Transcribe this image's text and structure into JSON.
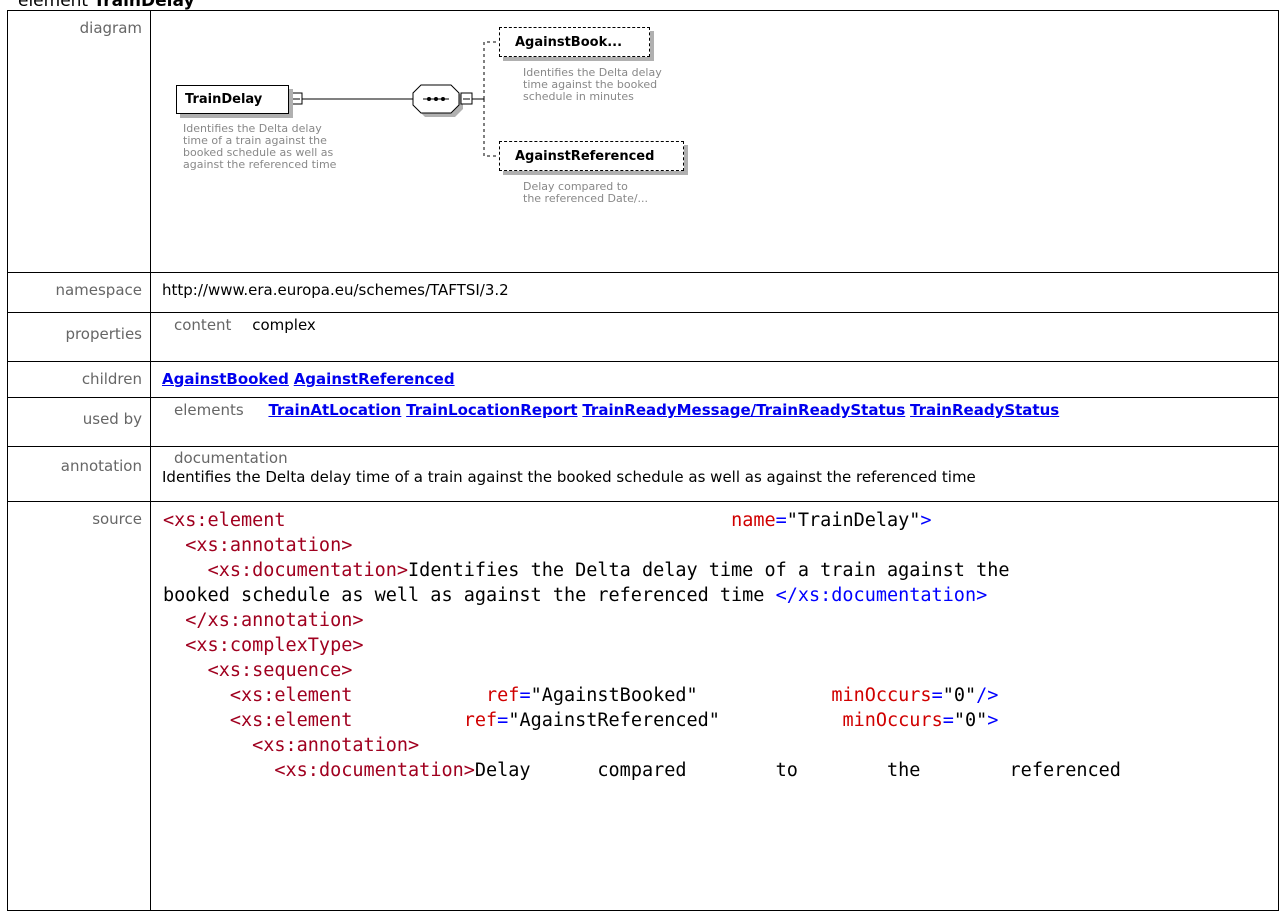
{
  "heading": {
    "prefix": "element",
    "name": "TrainDelay"
  },
  "labels": {
    "diagram": "diagram",
    "namespace": "namespace",
    "properties": "properties",
    "children": "children",
    "used_by": "used by",
    "annotation": "annotation",
    "source": "source"
  },
  "diagram": {
    "root_name": "TrainDelay",
    "root_desc": [
      "Identifies the Delta delay",
      "time of a train against the",
      "booked schedule as well as",
      "against the referenced time"
    ],
    "child1_name": "AgainstBook...",
    "child1_desc": [
      "Identifies the Delta delay",
      "time against the booked",
      "schedule in minutes"
    ],
    "child2_name": "AgainstReferenced",
    "child2_desc": [
      "Delay compared to",
      "the referenced Date/..."
    ]
  },
  "namespace": "http://www.era.europa.eu/schemes/TAFTSI/3.2",
  "properties": {
    "key": "content",
    "value": "complex"
  },
  "children": [
    "AgainstBooked",
    "AgainstReferenced"
  ],
  "used_by": {
    "key": "elements",
    "items": [
      "TrainAtLocation",
      "TrainLocationReport",
      "TrainReadyMessage/TrainReadyStatus",
      "TrainReadyStatus"
    ]
  },
  "annotation": {
    "key": "documentation",
    "text": "Identifies the Delta delay time of a train against the booked schedule as well as against the referenced time"
  },
  "source": {
    "l1_tag": "<xs:element",
    "l1_attr": "name",
    "l1_val": "\"TrainDelay\"",
    "l2": "<xs:annotation>",
    "l3_open": "<xs:documentation>",
    "l3_text": "Identifies the Delta delay time of a train against the",
    "l4_text": "booked schedule as well as against the referenced time ",
    "l4_close": "</xs:documentation>",
    "l5": "</xs:annotation>",
    "l6": "<xs:complexType>",
    "l7": "<xs:sequence>",
    "l8_tag": "<xs:element",
    "l8_attr1": "ref",
    "l8_val1": "\"AgainstBooked\"",
    "l8_attr2": "minOccurs",
    "l8_val2": "\"0\"",
    "l9_tag": "<xs:element",
    "l9_attr1": "ref",
    "l9_val1": "\"AgainstReferenced\"",
    "l9_attr2": "minOccurs",
    "l9_val2": "\"0\"",
    "l10": "<xs:annotation>",
    "l11_open": "<xs:documentation>",
    "l11_w1": "Delay",
    "l11_w2": "compared",
    "l11_w3": "to",
    "l11_w4": "the",
    "l11_w5": "referenced"
  }
}
